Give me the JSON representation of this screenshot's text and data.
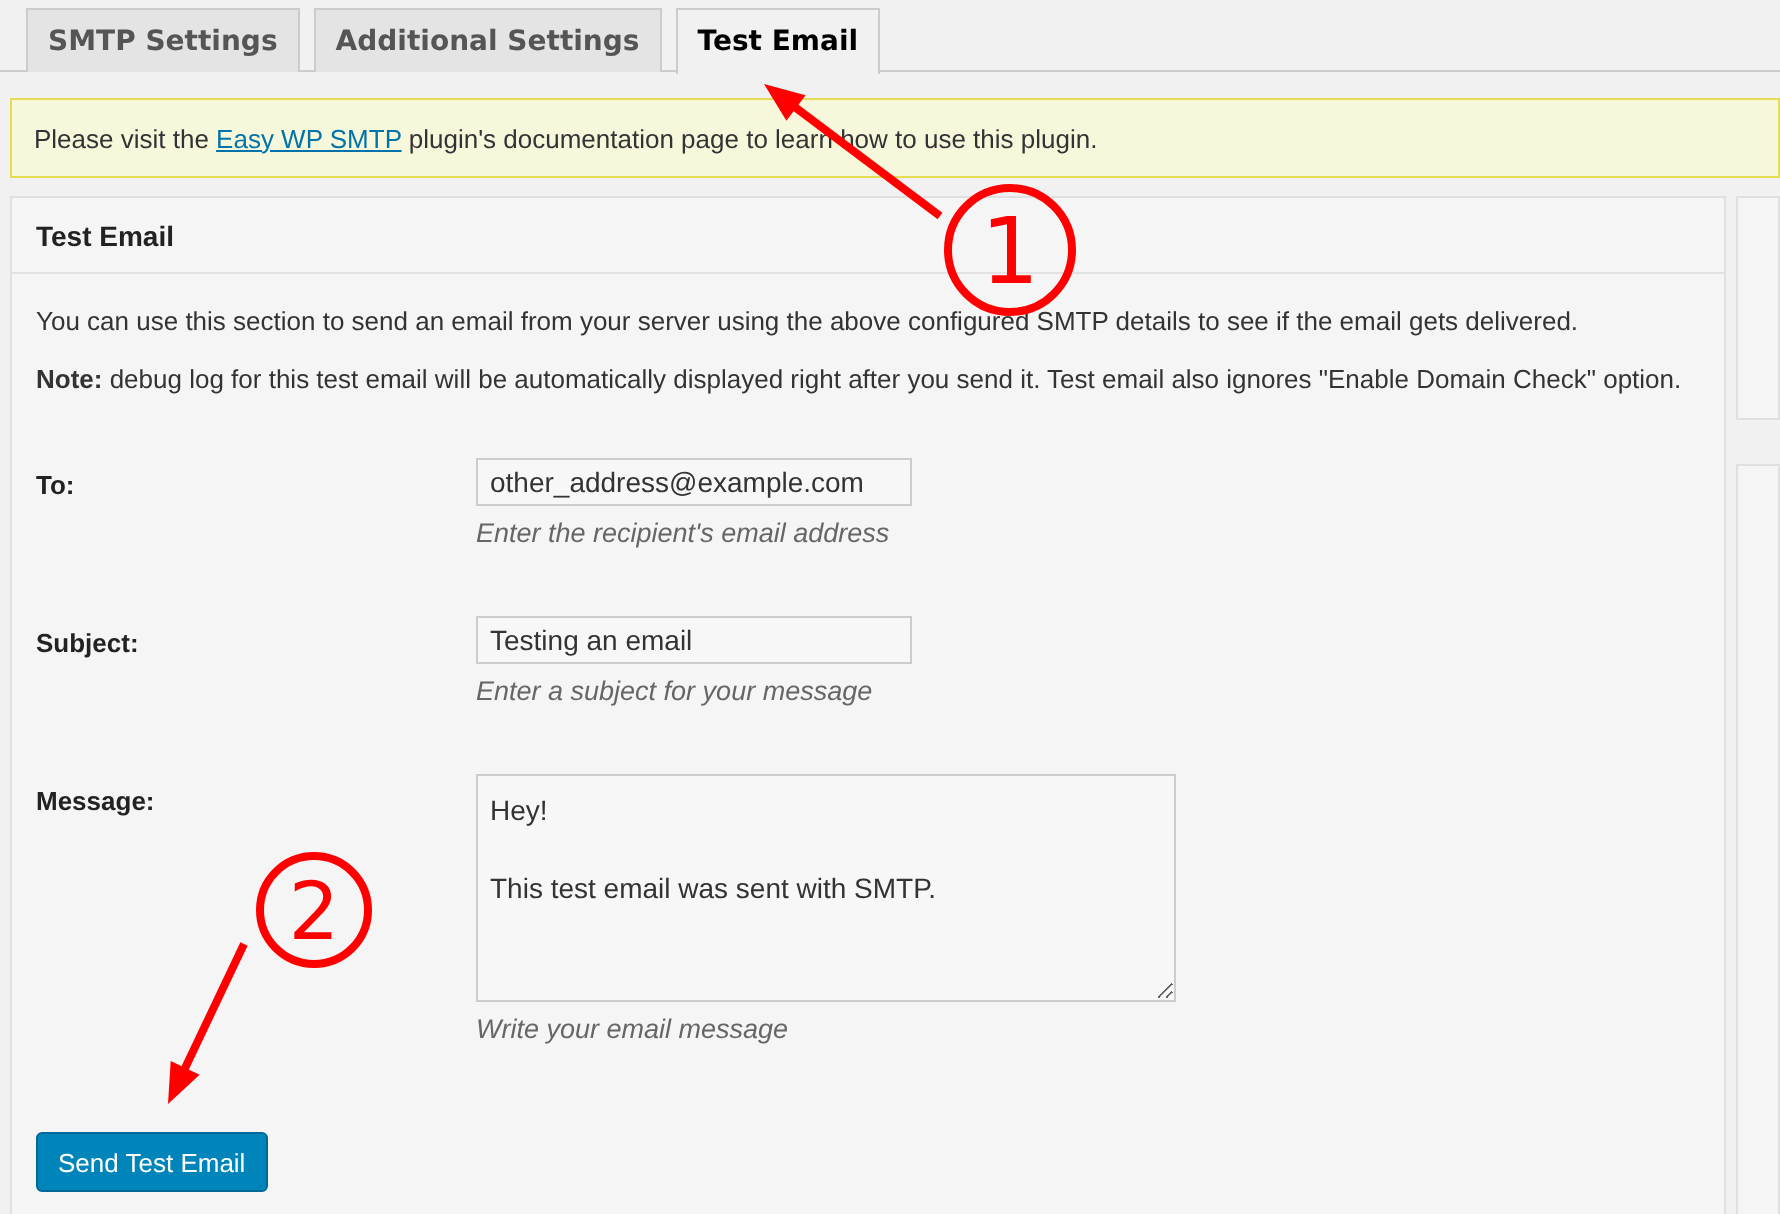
{
  "tabs": [
    {
      "label": "SMTP Settings",
      "selected": false
    },
    {
      "label": "Additional Settings",
      "selected": false
    },
    {
      "label": "Test Email",
      "selected": true
    }
  ],
  "notice": {
    "before": "Please visit the ",
    "link": "Easy WP SMTP",
    "after": " plugin's documentation page to learn how to use this plugin."
  },
  "panel": {
    "title": "Test Email",
    "intro": "You can use this section to send an email from your server using the above configured SMTP details to see if the email gets delivered.",
    "note": "**Note:** debug log for this test email will be automatically displayed right after you send it. Test email also ignores \"Enable Domain Check\" option.",
    "fields": [
      {
        "kind": "input",
        "label": "To:",
        "value": "other_address@example.com",
        "description": "Enter the recipient's email address"
      },
      {
        "kind": "input",
        "label": "Subject:",
        "value": "Testing an email",
        "description": "Enter a subject for your message"
      },
      {
        "kind": "textarea",
        "label": "Message:",
        "value": "Hey!\n\nThis test email was sent with SMTP.",
        "description": "Write your email message"
      }
    ],
    "button": "Send Test Email"
  },
  "annotations": [
    {
      "number": "1"
    },
    {
      "number": "2"
    }
  ]
}
